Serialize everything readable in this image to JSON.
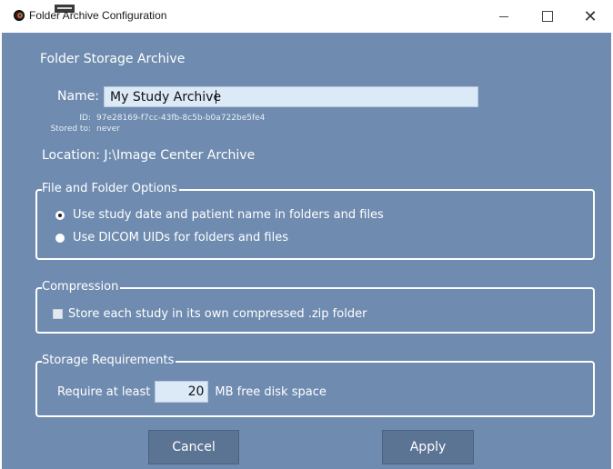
{
  "window": {
    "title": "Folder Archive Configuration",
    "close_glyph": "✕"
  },
  "form": {
    "section_title": "Folder Storage Archive",
    "name_label": "Name:",
    "name_value": "My Study Archive",
    "id_label": "ID:",
    "id_value": "97e28169-f7cc-43fb-8c5b-b0a722be5fe4",
    "stored_label": "Stored to:",
    "stored_value": "never",
    "location": "Location: J:\\Image Center Archive"
  },
  "file_folder_options": {
    "legend": "File and Folder Options",
    "options": [
      {
        "label": "Use study date and patient name in folders and files",
        "selected": true
      },
      {
        "label": "Use DICOM UIDs for folders and files",
        "selected": false
      }
    ]
  },
  "compression": {
    "legend": "Compression",
    "checkbox_label": "Store each study in its own compressed .zip folder",
    "checked": false
  },
  "storage": {
    "legend": "Storage Requirements",
    "prefix": "Require at least",
    "value": "20",
    "suffix": "MB free disk space"
  },
  "buttons": {
    "cancel": "Cancel",
    "apply": "Apply"
  },
  "colors": {
    "panel_bg": "#6f8cb0",
    "input_bg": "#dce9f7",
    "button_bg": "#5b7493"
  }
}
